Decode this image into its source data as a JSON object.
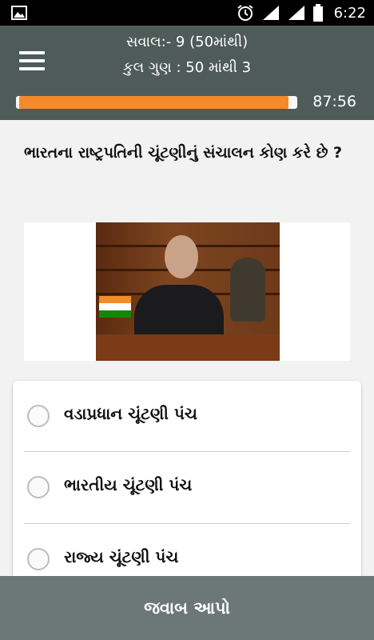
{
  "status_bar": {
    "time": "6:22",
    "icons": [
      "image-icon",
      "alarm-icon",
      "wifi-icon",
      "signal-icon",
      "battery-icon"
    ]
  },
  "header": {
    "question_counter": "સવાલ:- 9 (50માંથી)",
    "total_score": "કુલ ગુણ : 50 માંથી 3",
    "timer": "87:56",
    "progress": 0.98,
    "progress_color": "#f58a2a",
    "background_color": "#4f5b58"
  },
  "question": {
    "text": "ભારતના રાષ્ટ્રપતિની ચૂંટણીનું સંચાલન કોણ કરે છે ?"
  },
  "options": [
    {
      "label": "વડાપ્રધાન ચૂંટણી પંચ"
    },
    {
      "label": "ભારતીય ચૂંટણી પંચ"
    },
    {
      "label": "રાજ્ય ચૂંટણી પંચ"
    }
  ],
  "submit": {
    "label": "જવાબ આપો"
  }
}
